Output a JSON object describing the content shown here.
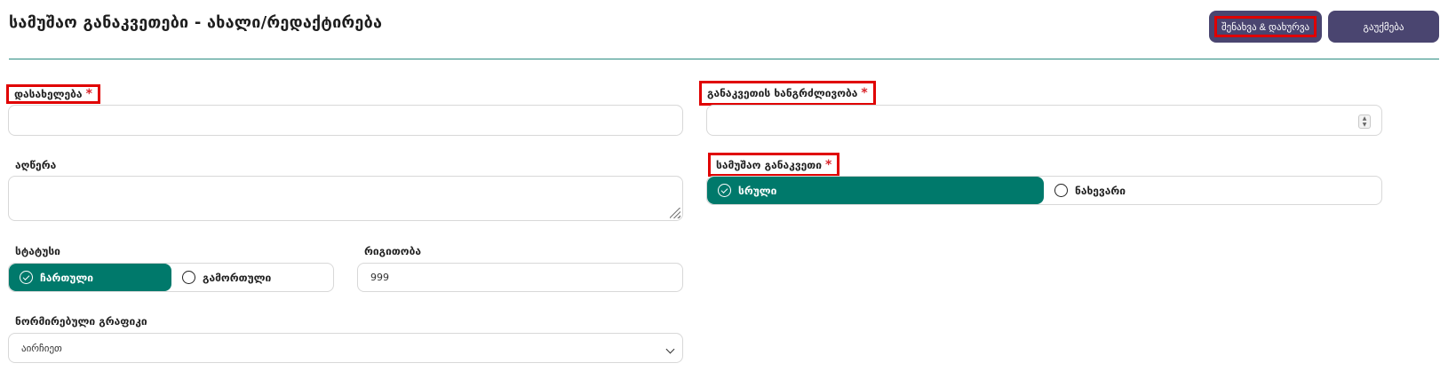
{
  "header": {
    "title": "სამუშაო განაკვეთები - ახალი/რედაქტირება",
    "save_label": "შენახვა & დახურვა",
    "cancel_label": "გაუქმება"
  },
  "form": {
    "name": {
      "label": "დასახელება",
      "required": "*",
      "value": ""
    },
    "duration": {
      "label": "განაკვეთის ხანგრძლივობა",
      "required": "*",
      "value": ""
    },
    "description": {
      "label": "აღწერა",
      "value": ""
    },
    "work_rate": {
      "label": "სამუშაო განაკვეთი",
      "required": "*",
      "options": [
        {
          "label": "სრული",
          "selected": true
        },
        {
          "label": "ნახევარი",
          "selected": false
        }
      ]
    },
    "status": {
      "label": "სტატუსი",
      "options": [
        {
          "label": "ჩართული",
          "selected": true
        },
        {
          "label": "გამორთული",
          "selected": false
        }
      ]
    },
    "order": {
      "label": "რიგითობა",
      "value": "999"
    },
    "schedule": {
      "label": "ნორმირებული გრაფიკი",
      "value": "აირჩიეთ"
    }
  },
  "colors": {
    "accent": "#00796b",
    "button": "#4a4570",
    "required": "#d9252b",
    "highlight": "#e00000"
  }
}
